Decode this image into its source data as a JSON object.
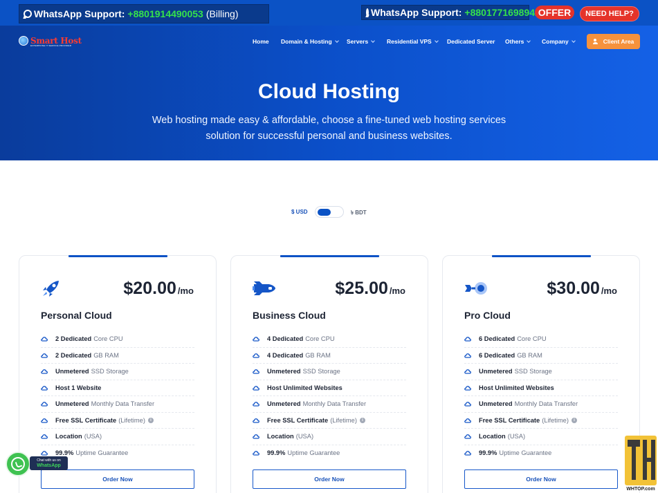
{
  "topbar": {
    "whatsapp1": {
      "label": "WhatsApp Support:",
      "number": "+8801914490053",
      "note": "(Billing)"
    },
    "whatsapp2": {
      "label": "WhatsApp Support:",
      "number": "+8801771698942"
    },
    "offer": "OFFER",
    "need_help": "NEED HELP?"
  },
  "logo": {
    "name": "Smart Host",
    "tagline": "ENTERPRISE IT SERVICE PROVIDER"
  },
  "nav": {
    "items": [
      {
        "label": "Home",
        "dropdown": false
      },
      {
        "label": "Domain & Hosting",
        "dropdown": true
      },
      {
        "label": "Servers",
        "dropdown": true
      },
      {
        "label": "Residential VPS",
        "dropdown": true
      },
      {
        "label": "Dedicated Server",
        "dropdown": false
      },
      {
        "label": "Others",
        "dropdown": true
      },
      {
        "label": "Company",
        "dropdown": true
      }
    ],
    "client_area": "Client Area"
  },
  "hero": {
    "title": "Cloud Hosting",
    "subtitle": "Web hosting made easy & affordable, choose a fine-tuned web hosting services solution for successful personal and business websites."
  },
  "currency_toggle": {
    "left": "$ USD",
    "right": "৳ BDT",
    "selected": "$ USD"
  },
  "plans": [
    {
      "name": "Personal Cloud",
      "price": "$20.00",
      "period": "/mo",
      "icon": "rocket-icon",
      "features": [
        {
          "bold": "2 Dedicated",
          "text": "Core CPU"
        },
        {
          "bold": "2 Dedicated",
          "text": "GB RAM"
        },
        {
          "bold": "Unmetered",
          "text": "SSD Storage"
        },
        {
          "bold": "Host 1 Website",
          "text": ""
        },
        {
          "bold": "Unmetered",
          "text": "Monthly Data Transfer"
        },
        {
          "bold": "Free SSL Certificate",
          "text": "(Lifetime)",
          "info": true
        },
        {
          "bold": "Location",
          "text": "(USA)"
        },
        {
          "bold": "99.9%",
          "text": "Uptime Guarantee"
        }
      ],
      "button": "Order Now"
    },
    {
      "name": "Business Cloud",
      "price": "$25.00",
      "period": "/mo",
      "icon": "shuttle-icon",
      "features": [
        {
          "bold": "4 Dedicated",
          "text": "Core CPU"
        },
        {
          "bold": "4 Dedicated",
          "text": "GB RAM"
        },
        {
          "bold": "Unmetered",
          "text": "SSD Storage"
        },
        {
          "bold": "Host Unlimited Websites",
          "text": ""
        },
        {
          "bold": "Unmetered",
          "text": "Monthly Data Transfer"
        },
        {
          "bold": "Free SSL Certificate",
          "text": "(Lifetime)",
          "info": true
        },
        {
          "bold": "Location",
          "text": "(USA)"
        },
        {
          "bold": "99.9%",
          "text": "Uptime Guarantee"
        }
      ],
      "button": "Order Now"
    },
    {
      "name": "Pro Cloud",
      "price": "$30.00",
      "period": "/mo",
      "icon": "satellite-icon",
      "features": [
        {
          "bold": "6 Dedicated",
          "text": "Core CPU"
        },
        {
          "bold": "6 Dedicated",
          "text": "GB RAM"
        },
        {
          "bold": "Unmetered",
          "text": "SSD Storage"
        },
        {
          "bold": "Host Unlimited Websites",
          "text": ""
        },
        {
          "bold": "Unmetered",
          "text": "Monthly Data Transfer"
        },
        {
          "bold": "Free SSL Certificate",
          "text": "(Lifetime)",
          "info": true
        },
        {
          "bold": "Location",
          "text": "(USA)"
        },
        {
          "bold": "99.9%",
          "text": "Uptime Guarantee"
        }
      ],
      "button": "Order Now"
    }
  ],
  "whatsapp_widget": {
    "line1": "Chat with us on",
    "line2": "WhatsApp"
  },
  "watermark": {
    "url": "WHTOP.com"
  },
  "colors": {
    "primary": "#0b52c5",
    "accent_green": "#35e24b",
    "offer_red": "#e5332a",
    "client_orange": "#f6923d"
  }
}
